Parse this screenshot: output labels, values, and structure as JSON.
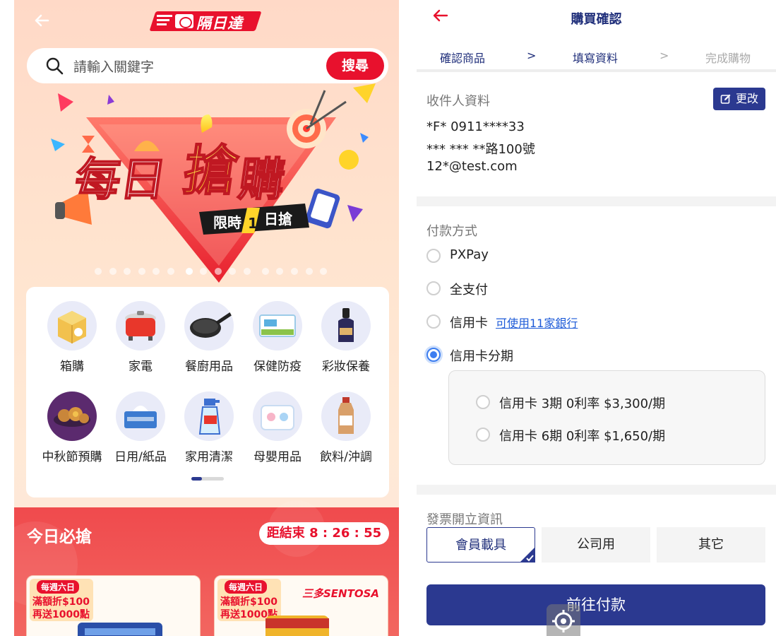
{
  "left_app": {
    "logo_text": "隔日達",
    "search": {
      "placeholder": "請輸入關鍵字",
      "button": "搜尋"
    },
    "banner": {
      "title": "每日搶購",
      "subtitle": "限時1日搶",
      "dot_count": 16,
      "active_dot": 6
    },
    "categories": [
      {
        "label": "箱購",
        "icon": "box-icon"
      },
      {
        "label": "家電",
        "icon": "rice-cooker-icon"
      },
      {
        "label": "餐廚用品",
        "icon": "frying-pan-icon"
      },
      {
        "label": "保健防疫",
        "icon": "mask-box-icon"
      },
      {
        "label": "彩妝保養",
        "icon": "serum-bottle-icon"
      },
      {
        "label": "中秋節預購",
        "icon": "mooncake-icon"
      },
      {
        "label": "日用/紙品",
        "icon": "tissue-box-icon"
      },
      {
        "label": "家用清潔",
        "icon": "spray-bottle-icon"
      },
      {
        "label": "母嬰用品",
        "icon": "diaper-pack-icon"
      },
      {
        "label": "飲料/沖調",
        "icon": "drink-bottle-icon"
      }
    ],
    "deal": {
      "title": "今日必搶",
      "timer_label": "距結束",
      "timer": "8 : 26 : 55",
      "cards": [
        {
          "tag": "每週六日",
          "line1": "滿額折$100",
          "line2": "再送1000點",
          "brand": ""
        },
        {
          "tag": "每週六日",
          "line1": "滿額折$100",
          "line2": "再送1000點",
          "brand": "三多SENTOSA"
        }
      ]
    }
  },
  "checkout": {
    "title": "購買確認",
    "steps": [
      {
        "label": "確認商品",
        "state": "done"
      },
      {
        "label": ">",
        "state": "done"
      },
      {
        "label": "填寫資料",
        "state": "done"
      },
      {
        "label": ">",
        "state": "pending"
      },
      {
        "label": "完成購物",
        "state": "pending"
      }
    ],
    "recipient": {
      "label": "收件人資料",
      "edit_button": "更改",
      "name_phone": "*F* 0911****33",
      "address": "*** *** **路100號",
      "email": "12*@test.com"
    },
    "payment": {
      "label": "付款方式",
      "options": [
        {
          "label": "PXPay",
          "selected": false
        },
        {
          "label": "全支付",
          "selected": false
        },
        {
          "label": "信用卡",
          "selected": false,
          "link": "可使用11家銀行"
        },
        {
          "label": "信用卡分期",
          "selected": true
        }
      ],
      "installments": [
        {
          "label": "信用卡 3期 0利率 $3,300/期",
          "selected": false
        },
        {
          "label": "信用卡 6期 0利率 $1,650/期",
          "selected": false
        }
      ]
    },
    "invoice": {
      "label": "發票開立資訊",
      "tabs": [
        {
          "label": "會員載具",
          "selected": true
        },
        {
          "label": "公司用",
          "selected": false
        },
        {
          "label": "其它",
          "selected": false
        }
      ]
    },
    "pay_button": "前往付款"
  },
  "colors": {
    "brand_red": "#e8112d",
    "navy": "#2b3990",
    "radio_blue": "#3d7ef0",
    "link_blue": "#1e5bd8"
  }
}
